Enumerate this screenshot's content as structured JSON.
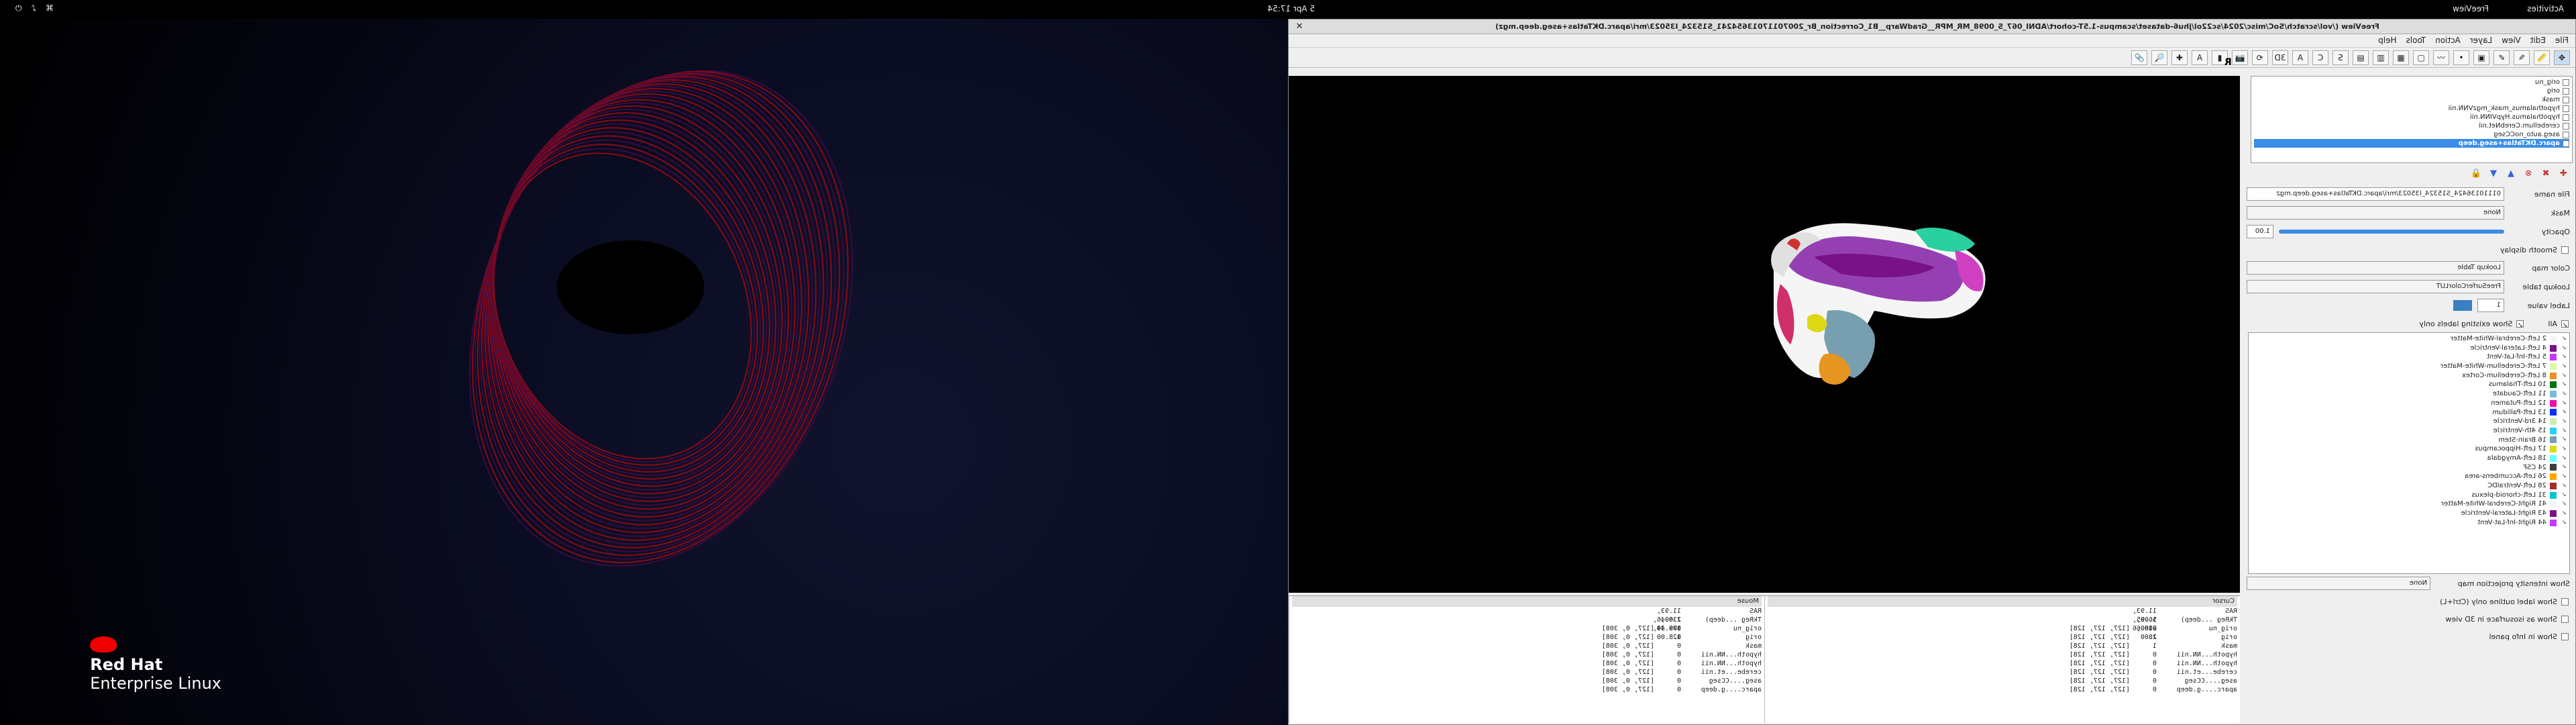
{
  "topbar": {
    "activities": "Activities",
    "app": "FreeView",
    "clock": "5 Apr  17:54"
  },
  "desktop": {
    "logo_line1": "Red Hat",
    "logo_line2": "Enterprise Linux"
  },
  "window": {
    "title": "FreeView (/vol/scratch/SoC/misc/2024/sc22ol/jhu6-dataset/scampus-1.5T-cohort/ADNI_067_S_0098_MR_MPR__GradWarp__B1_Correction_Br_20070117013654241_S15324_I35023/mri/aparc.DKTatlas+aseg.deep.mgz)",
    "close": "✕",
    "menu": [
      "File",
      "Edit",
      "View",
      "Layer",
      "Action",
      "Tools",
      "Help"
    ],
    "toolbar_icons": [
      "navigate-icon",
      "measure-icon",
      "voxel-edit-icon",
      "recon-edit-icon",
      "roi-edit-icon",
      "pointset-edit-icon",
      "contour-icon",
      "layout-1x1-icon",
      "layout-2x2-icon",
      "layout-1x3-icon",
      "layout-1x3v-icon",
      "sagittal-icon",
      "coronal-icon",
      "axial-icon",
      "3d-icon",
      "reset-view-icon",
      "snapshot-icon",
      "color-bar-icon",
      "text-icon",
      "cursor-icon",
      "zoom-icon",
      "link-icon"
    ],
    "orientation_label": "R"
  },
  "layers": [
    "orig_nu",
    "orig",
    "mask",
    "hypothalamus_mask_mgzVNN.nii",
    "hypothalamus.HypVINN.nii",
    "cerebellum.CerebNet.nii",
    "aseg.auto_noCCseg",
    "aparc.DKTatlas+aseg.deep"
  ],
  "props": {
    "file_name_label": "File name",
    "file_name": "01110136424_S15324_I35023/mri/aparc.DKTatlas+aseg.deep.mgz",
    "mask_label": "Mask",
    "mask": "None",
    "opacity_label": "Opacity",
    "opacity": "1.00",
    "smooth": "Smooth display",
    "colormap_label": "Color map",
    "colormap": "Lookup Table",
    "lut_label": "Lookup table",
    "lut": "FreeSurferColorLUT",
    "label_value_label": "Label value",
    "label_value": "1",
    "all_label": "All",
    "show_existing": "Show existing labels only"
  },
  "labels": [
    {
      "n": "2 Left-Cerebral-White-Matter",
      "c": "#f5f5f5"
    },
    {
      "n": "4 Left-Lateral-Ventricle",
      "c": "#781286"
    },
    {
      "n": "5 Left-Inf-Lat-Vent",
      "c": "#c43afa"
    },
    {
      "n": "7 Left-Cerebellum-White-Matter",
      "c": "#dcf8a4"
    },
    {
      "n": "8 Left-Cerebellum-Cortex",
      "c": "#e69422"
    },
    {
      "n": "10 Left-Thalamus",
      "c": "#00760e"
    },
    {
      "n": "11 Left-Caudate",
      "c": "#7aba dc"
    },
    {
      "n": "12 Left-Putamen",
      "c": "#ec0db0"
    },
    {
      "n": "13 Left-Pallidum",
      "c": "#0c30ff"
    },
    {
      "n": "14 3rd-Ventricle",
      "c": "#cceeb6"
    },
    {
      "n": "15 4th-Ventricle",
      "c": "#2ad0ef"
    },
    {
      "n": "16 Brain-Stem",
      "c": "#779fb0"
    },
    {
      "n": "17 Left-Hippocampus",
      "c": "#dcd814"
    },
    {
      "n": "18 Left-Amygdala",
      "c": "#67ffff"
    },
    {
      "n": "24 CSF",
      "c": "#3c3c3c"
    },
    {
      "n": "26 Left-Accumbens-area",
      "c": "#ffa500"
    },
    {
      "n": "28 Left-VentralDC",
      "c": "#a52a2a"
    },
    {
      "n": "31 Left-choroid-plexus",
      "c": "#00c8c8"
    },
    {
      "n": "41 Right-Cerebral-White-Matter",
      "c": "#f5f5f5"
    },
    {
      "n": "43 Right-Lateral-Ventricle",
      "c": "#781286"
    },
    {
      "n": "44 Right-Inf-Lat-Vent",
      "c": "#c43afa"
    }
  ],
  "checks": {
    "projection": "Show intensity projection map",
    "projection_val": "None",
    "outline": "Show label outline only (Ctrl+L)",
    "iso3d": "Show as isosurface in 3D view",
    "infopanel": "Show in Info panel"
  },
  "info": {
    "cursor_hd": "Cursor",
    "mouse_hd": "Mouse",
    "cursor": [
      [
        "RAS",
        "11.93, 56.95, -18.66",
        ""
      ],
      [
        "TkReg ...deep)",
        "1.00, 0.00, 1.00",
        ""
      ],
      [
        "orig_nu",
        "28",
        "[127, 127, 128]"
      ],
      [
        "orig",
        "28",
        "[127, 127, 128]"
      ],
      [
        "mask",
        "1",
        "[127, 127, 128]"
      ],
      [
        "hypoth...NN.nii",
        "0",
        "[127, 127, 128]"
      ],
      [
        "hypoth...NN.nii",
        "0",
        "[127, 127, 128]"
      ],
      [
        "cerebe...et.nii",
        "0",
        "[127, 127, 128]"
      ],
      [
        "aseg....CCseg",
        "0",
        "[127, 127, 128]"
      ],
      [
        "aparc....g.deep",
        "0",
        "[127, 127, 128]"
      ]
    ],
    "mouse": [
      [
        "RAS",
        "11.93, 236.46, 108.34",
        ""
      ],
      [
        "TkReg ...deep)",
        "1.00, 179.49, 128.00",
        ""
      ],
      [
        "orig_nu",
        "0",
        "[127, 0, 308]"
      ],
      [
        "orig",
        "0",
        "[127, 0, 308]"
      ],
      [
        "mask",
        "0",
        "[127, 0, 308]"
      ],
      [
        "hypoth...NN.nii",
        "0",
        "[127, 0, 308]"
      ],
      [
        "hypoth...NN.nii",
        "0",
        "[127, 0, 308]"
      ],
      [
        "cerebe...et.nii",
        "0",
        "[127, 0, 308]"
      ],
      [
        "aseg....CCseg",
        "0",
        "[127, 0, 308]"
      ],
      [
        "aparc....g.deep",
        "0",
        "[127, 0, 308]"
      ]
    ]
  }
}
